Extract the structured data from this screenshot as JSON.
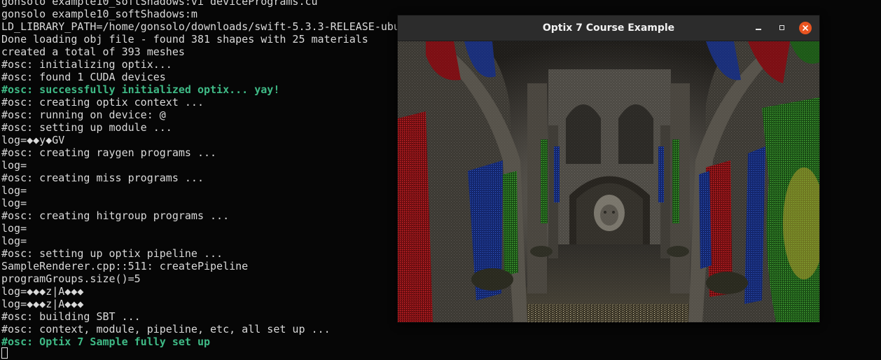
{
  "terminal": {
    "lines": [
      {
        "text": "gonsolo example10_softShadows:vi devicePrograms.cu",
        "style": "normal"
      },
      {
        "text": "gonsolo example10_softShadows:m",
        "style": "normal"
      },
      {
        "text": "LD_LIBRARY_PATH=/home/gonsolo/downloads/swift-5.3.3-RELEASE-ubu",
        "style": "normal"
      },
      {
        "text": "Done loading obj file - found 381 shapes with 25 materials",
        "style": "normal"
      },
      {
        "text": "created a total of 393 meshes",
        "style": "normal"
      },
      {
        "text": "#osc: initializing optix...",
        "style": "normal"
      },
      {
        "text": "#osc: found 1 CUDA devices",
        "style": "normal"
      },
      {
        "text": "#osc: successfully initialized optix... yay!",
        "style": "green"
      },
      {
        "text": "#osc: creating optix context ...",
        "style": "normal"
      },
      {
        "text": "#osc: running on device: @",
        "style": "normal"
      },
      {
        "text": "#osc: setting up module ...",
        "style": "normal"
      },
      {
        "text": "log=◆◆y◆GV",
        "style": "normal"
      },
      {
        "text": "#osc: creating raygen programs ...",
        "style": "normal"
      },
      {
        "text": "log=",
        "style": "normal"
      },
      {
        "text": "#osc: creating miss programs ...",
        "style": "normal"
      },
      {
        "text": "log=",
        "style": "normal"
      },
      {
        "text": "log=",
        "style": "normal"
      },
      {
        "text": "#osc: creating hitgroup programs ...",
        "style": "normal"
      },
      {
        "text": "log=",
        "style": "normal"
      },
      {
        "text": "log=",
        "style": "normal"
      },
      {
        "text": "#osc: setting up optix pipeline ...",
        "style": "normal"
      },
      {
        "text": "SampleRenderer.cpp::511: createPipeline",
        "style": "normal"
      },
      {
        "text": "programGroups.size()=5",
        "style": "normal"
      },
      {
        "text": "log=◆◆◆z|A◆◆◆",
        "style": "normal"
      },
      {
        "text": "log=◆◆◆z|A◆◆◆",
        "style": "normal"
      },
      {
        "text": "#osc: building SBT ...",
        "style": "normal"
      },
      {
        "text": "#osc: context, module, pipeline, etc, all set up ...",
        "style": "normal"
      },
      {
        "text": "#osc: Optix 7 Sample fully set up",
        "style": "green"
      }
    ]
  },
  "window": {
    "title": "Optix 7 Course Example",
    "buttons": {
      "minimize_icon": "minimize-icon",
      "maximize_icon": "maximize-icon",
      "close_icon": "close-icon"
    },
    "accent_close": "#e95420"
  },
  "colors": {
    "terminal_bg": "#060606",
    "terminal_fg": "#d9d9d9",
    "terminal_green": "#3fba86",
    "titlebar_bg": "#2c2c2c"
  }
}
